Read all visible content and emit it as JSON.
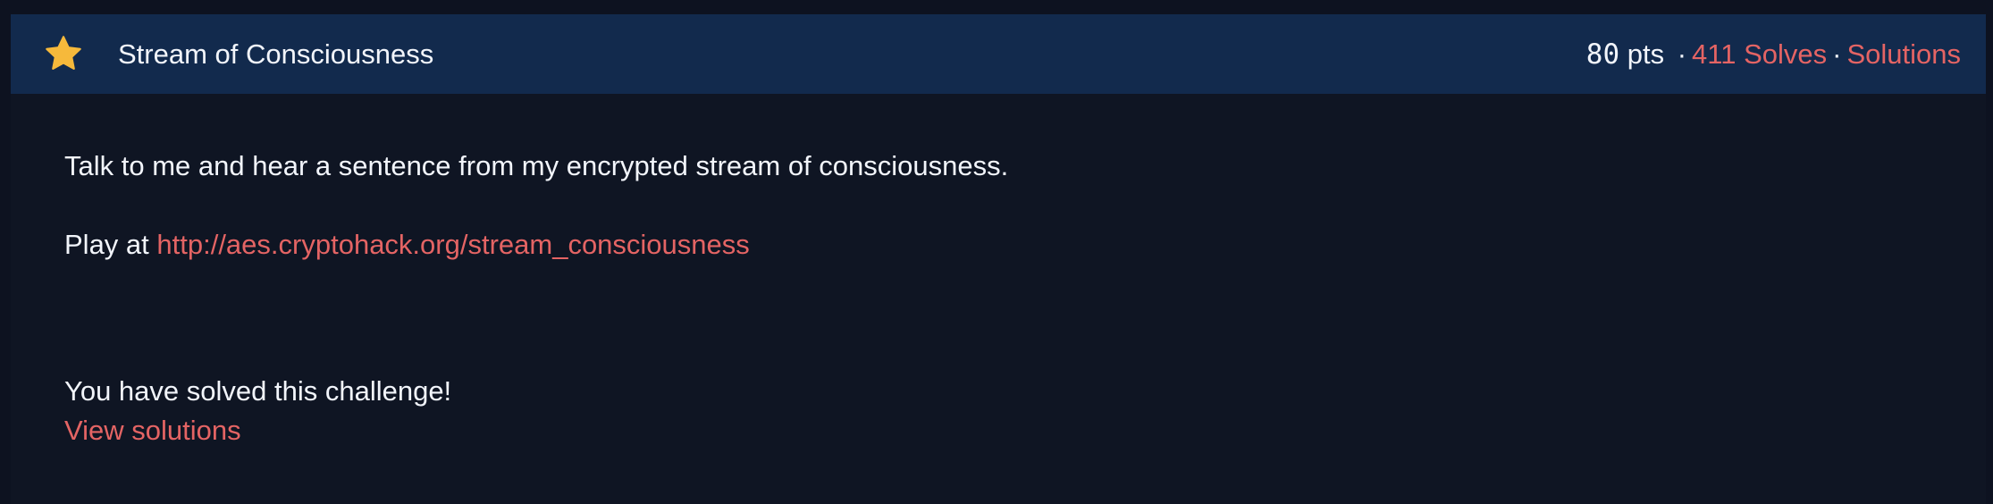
{
  "challenge": {
    "title": "Stream of Consciousness",
    "points_value": "80",
    "points_suffix": " pts",
    "separator": "·",
    "solves_label": "411 Solves",
    "solutions_label": "Solutions"
  },
  "description": {
    "intro": "Talk to me and hear a sentence from my encrypted stream of consciousness.",
    "play_prefix": "Play at ",
    "play_link": "http://aes.cryptohack.org/stream_consciousness"
  },
  "status": {
    "solved_message": "You have solved this challenge!",
    "view_solutions_label": "View solutions"
  },
  "colors": {
    "background": "#0d1220",
    "header": "#122a4d",
    "accent": "#e46464",
    "star": "#f6b93b",
    "text": "#f2f5fb"
  },
  "icons": {
    "header_icon": "star-icon"
  }
}
